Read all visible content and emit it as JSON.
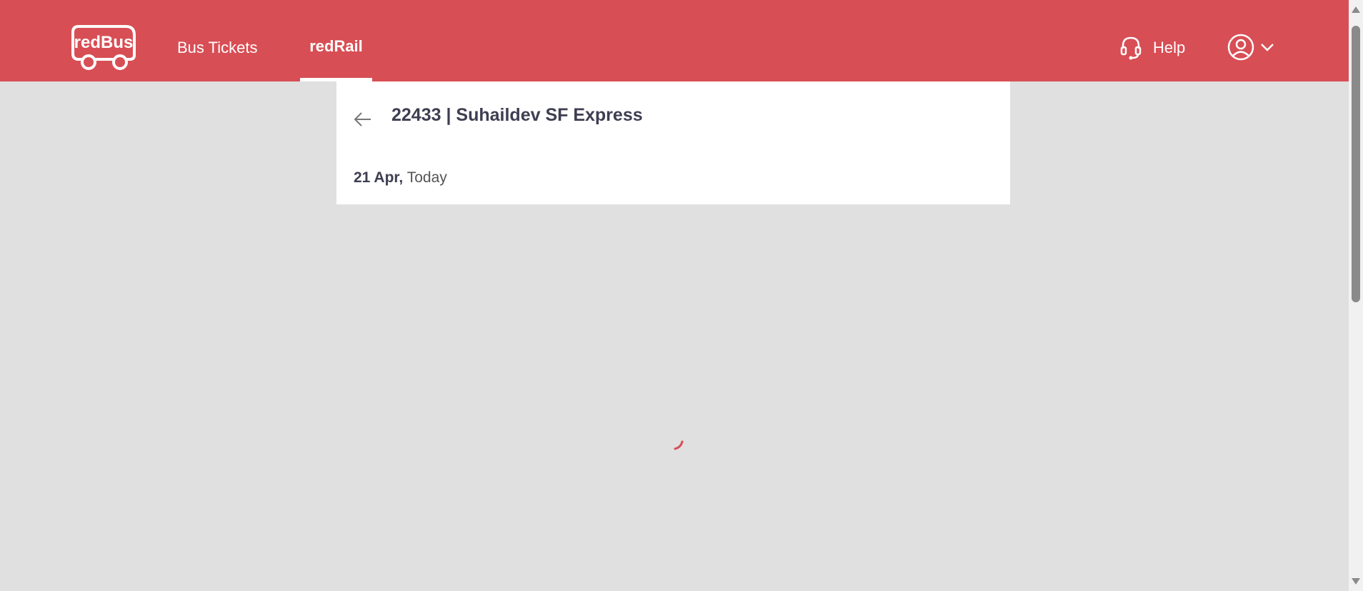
{
  "header": {
    "brand": "redBus",
    "nav": [
      {
        "label": "Bus Tickets",
        "active": false
      },
      {
        "label": "redRail",
        "active": true
      }
    ],
    "help_label": "Help",
    "colors": {
      "brand": "#d84e55",
      "text": "#ffffff"
    }
  },
  "train": {
    "title": "22433 | Suhaildev SF Express",
    "date": "21 Apr,",
    "day": "Today"
  },
  "icons": {
    "back": "arrow-left-icon",
    "help": "headset-icon",
    "user": "user-circle-icon",
    "menu": "chevron-down-icon",
    "loading": "spinner-icon"
  },
  "colors": {
    "background": "#e0e0e0",
    "card": "#ffffff",
    "title_text": "#3e3e52",
    "spinner": "#d84e55"
  }
}
